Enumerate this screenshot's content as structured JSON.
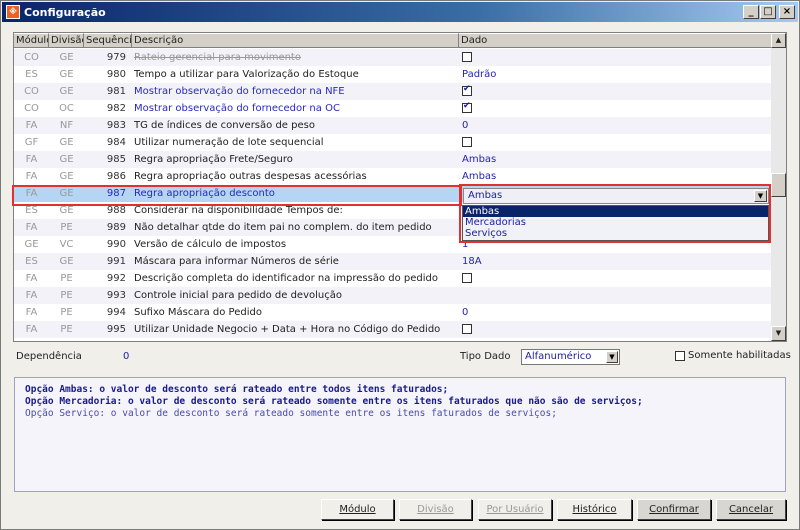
{
  "window": {
    "title": "Configuração",
    "controls": [
      "_",
      "□",
      "×"
    ]
  },
  "grid": {
    "columns": [
      "Módulo",
      "Divisão",
      "Sequência",
      "Descrição",
      "Dado"
    ],
    "rows": [
      {
        "modulo": "CO",
        "divisao": "GE",
        "seq": "979",
        "desc": "Rateio gerencial para movimento",
        "dado": "",
        "type": "check",
        "checked": false,
        "style": "strike"
      },
      {
        "modulo": "ES",
        "divisao": "GE",
        "seq": "980",
        "desc": "Tempo a utilizar para Valorização do Estoque",
        "dado": "Padrão",
        "type": "text",
        "style": ""
      },
      {
        "modulo": "CO",
        "divisao": "GE",
        "seq": "981",
        "desc": "Mostrar observação do fornecedor na NFE",
        "dado": "",
        "type": "check",
        "checked": true,
        "style": "blue"
      },
      {
        "modulo": "CO",
        "divisao": "OC",
        "seq": "982",
        "desc": "Mostrar observação do fornecedor na OC",
        "dado": "",
        "type": "check",
        "checked": true,
        "style": "blue"
      },
      {
        "modulo": "FA",
        "divisao": "NF",
        "seq": "983",
        "desc": "TG de índices de conversão de peso",
        "dado": "0",
        "type": "text",
        "style": ""
      },
      {
        "modulo": "GF",
        "divisao": "GE",
        "seq": "984",
        "desc": "Utilizar numeração de lote sequencial",
        "dado": "",
        "type": "check",
        "checked": false,
        "style": ""
      },
      {
        "modulo": "FA",
        "divisao": "GE",
        "seq": "985",
        "desc": "Regra apropriação Frete/Seguro",
        "dado": "Ambas",
        "type": "text",
        "style": ""
      },
      {
        "modulo": "FA",
        "divisao": "GE",
        "seq": "986",
        "desc": "Regra apropriação outras despesas acessórias",
        "dado": "Ambas",
        "type": "text",
        "style": ""
      },
      {
        "modulo": "FA",
        "divisao": "GE",
        "seq": "987",
        "desc": "Regra apropriação desconto",
        "dado": "",
        "type": "none",
        "style": "selected"
      },
      {
        "modulo": "ES",
        "divisao": "GE",
        "seq": "988",
        "desc": "Considerar na disponibilidade Tempos de:",
        "dado": "",
        "type": "none",
        "style": ""
      },
      {
        "modulo": "FA",
        "divisao": "PE",
        "seq": "989",
        "desc": "Não detalhar qtde do item pai no complem. do item pedido",
        "dado": "",
        "type": "none",
        "style": ""
      },
      {
        "modulo": "GE",
        "divisao": "VC",
        "seq": "990",
        "desc": "Versão de cálculo de impostos",
        "dado": "1",
        "type": "text",
        "style": ""
      },
      {
        "modulo": "ES",
        "divisao": "GE",
        "seq": "991",
        "desc": "Máscara para informar Números de série",
        "dado": "18A",
        "type": "text",
        "style": ""
      },
      {
        "modulo": "FA",
        "divisao": "PE",
        "seq": "992",
        "desc": "Descrição completa do identificador na impressão do pedido",
        "dado": "",
        "type": "check",
        "checked": false,
        "style": ""
      },
      {
        "modulo": "FA",
        "divisao": "PE",
        "seq": "993",
        "desc": "Controle inicial para pedido de devolução",
        "dado": "",
        "type": "none",
        "style": ""
      },
      {
        "modulo": "FA",
        "divisao": "PE",
        "seq": "994",
        "desc": "Sufixo Máscara do Pedido",
        "dado": "0",
        "type": "text",
        "style": ""
      },
      {
        "modulo": "FA",
        "divisao": "PE",
        "seq": "995",
        "desc": "Utilizar Unidade Negocio + Data + Hora no Código do Pedido",
        "dado": "",
        "type": "check",
        "checked": false,
        "style": ""
      }
    ],
    "editor": {
      "value": "Ambas",
      "options": [
        "Ambas",
        "Mercadorias",
        "Serviços"
      ],
      "highlighted": "Ambas"
    }
  },
  "footer": {
    "dependencia_label": "Dependência",
    "dependencia_value": "0",
    "tipo_dado_label": "Tipo Dado",
    "tipo_dado_value": "Alfanumérico",
    "somente_label": "Somente habilitadas"
  },
  "memo": [
    "Opção Ambas: o valor de desconto será rateado entre todos itens faturados;",
    "Opção Mercadoria: o valor de desconto será rateado somente entre os itens faturados que não são de serviços;",
    "Opção Serviço: o valor de desconto será rateado somente entre os itens faturados de serviços;"
  ],
  "buttons": {
    "modulo": "Módulo",
    "divisao": "Divisão",
    "por_usuario": "Por Usuário",
    "historico": "Histórico",
    "confirmar": "Confirmar",
    "cancelar": "Cancelar"
  }
}
